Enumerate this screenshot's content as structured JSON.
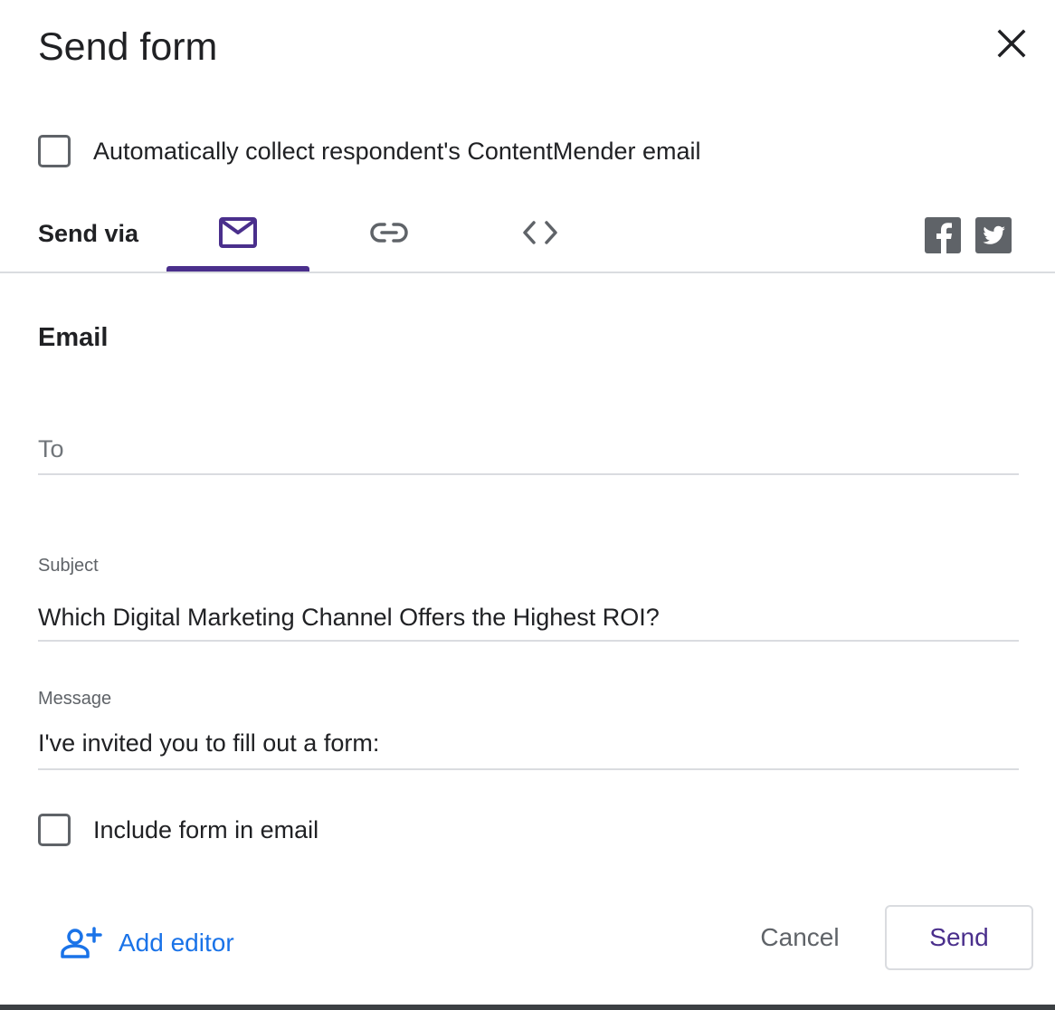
{
  "dialog": {
    "title": "Send form",
    "close_icon": "close-icon"
  },
  "collect_email": {
    "label": "Automatically collect respondent's ContentMender email",
    "checked": false
  },
  "send_via": {
    "label": "Send via",
    "tabs": [
      {
        "icon": "mail-icon",
        "selected": true
      },
      {
        "icon": "link-icon",
        "selected": false
      },
      {
        "icon": "embed-code-icon",
        "selected": false
      }
    ],
    "social": [
      {
        "icon": "facebook-icon"
      },
      {
        "icon": "twitter-icon"
      }
    ]
  },
  "email": {
    "section_title": "Email",
    "to": {
      "placeholder": "To",
      "value": ""
    },
    "subject": {
      "label": "Subject",
      "value": "Which Digital Marketing Channel Offers the Highest ROI?"
    },
    "message": {
      "label": "Message",
      "value": "I've invited you to fill out a form:"
    },
    "include_form": {
      "label": "Include form in email",
      "checked": false
    }
  },
  "footer": {
    "add_editor_label": "Add editor",
    "cancel_label": "Cancel",
    "send_label": "Send"
  },
  "colors": {
    "accent": "#4a2f8c",
    "link": "#1a73e8",
    "divider": "#dadce0",
    "icon_gray": "#5f6368"
  }
}
